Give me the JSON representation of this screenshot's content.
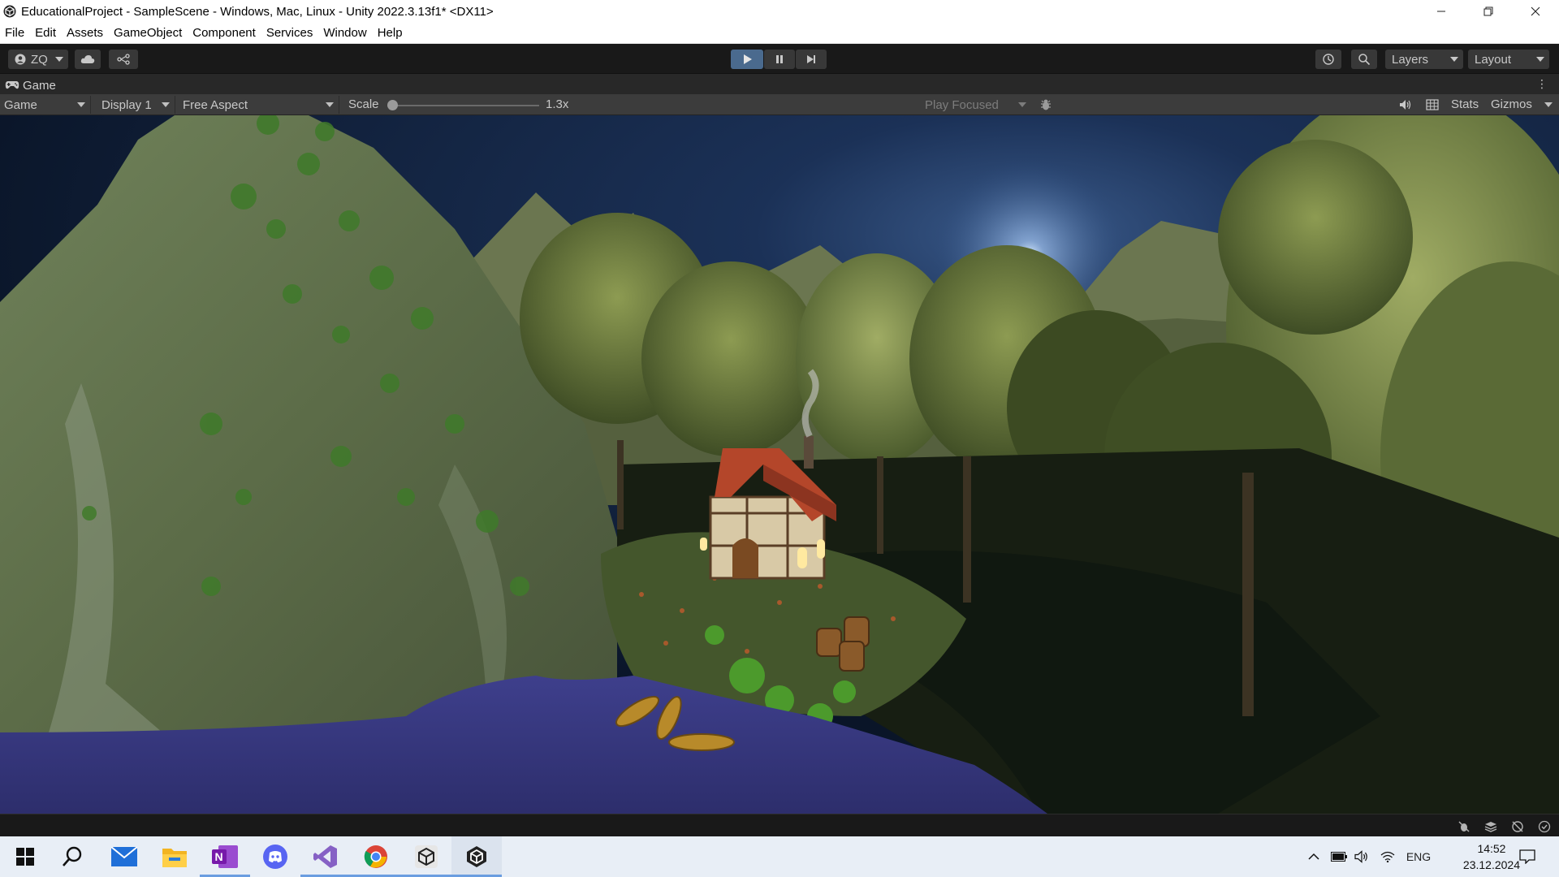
{
  "window": {
    "title": "EducationalProject - SampleScene - Windows, Mac, Linux - Unity 2022.3.13f1* <DX11>",
    "minimize_icon": "minimize-icon",
    "maximize_icon": "restore-icon",
    "close_icon": "close-icon"
  },
  "menu": [
    "File",
    "Edit",
    "Assets",
    "GameObject",
    "Component",
    "Services",
    "Window",
    "Help"
  ],
  "toolbar": {
    "account_label": "ZQ",
    "play_state": "playing",
    "layers_label": "Layers",
    "layout_label": "Layout",
    "accent_color": "#4a6a8e"
  },
  "game_tab": {
    "label": "Game",
    "icon": "gamepad-icon"
  },
  "game_bar": {
    "view_mode": "Game",
    "display": "Display 1",
    "aspect": "Free Aspect",
    "scale_label": "Scale",
    "scale_value": "1.3x",
    "scale_fraction": 0.0,
    "play_mode": "Play Focused",
    "stats_label": "Stats",
    "gizmos_label": "Gizmos"
  },
  "taskbar": {
    "apps": [
      "windows-start-icon",
      "search-icon",
      "mail-icon",
      "file-explorer-icon",
      "onenote-icon",
      "discord-icon",
      "visual-studio-icon",
      "chrome-icon",
      "unity-hub-icon",
      "unity-editor-icon"
    ],
    "language": "ENG",
    "time": "14:52",
    "date": "23.12.2024"
  }
}
